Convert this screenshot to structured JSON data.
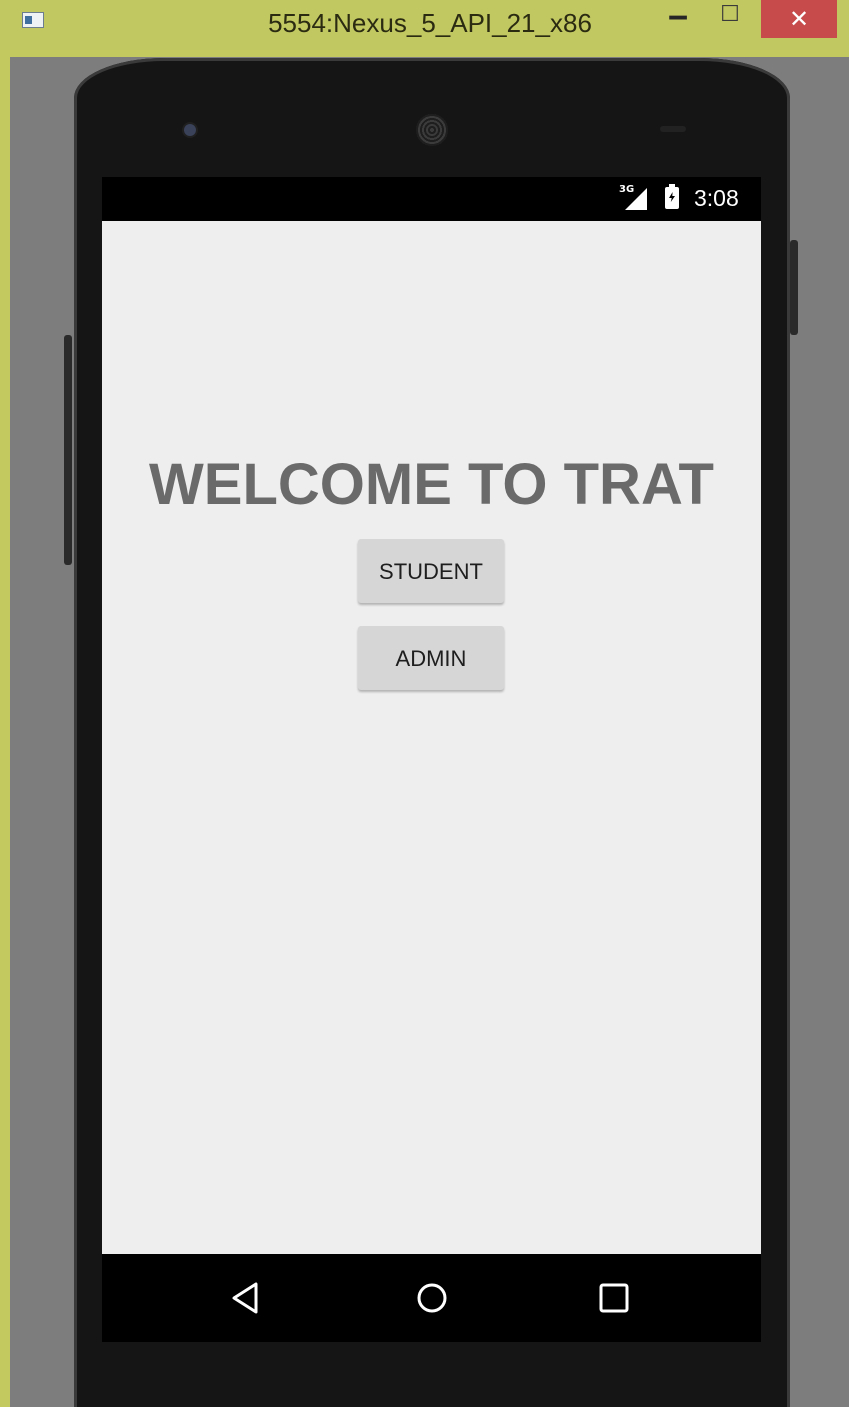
{
  "window": {
    "title": "5554:Nexus_5_API_21_x86",
    "minimize_glyph": "‒",
    "maximize_glyph": "☐",
    "close_glyph": "✕"
  },
  "status_bar": {
    "network_type": "3G",
    "time": "3:08",
    "icons": [
      "signal-icon",
      "battery-charging-icon"
    ]
  },
  "app": {
    "heading": "WELCOME TO TRAT",
    "buttons": {
      "student_label": "STUDENT",
      "admin_label": "ADMIN"
    }
  },
  "nav_bar": {
    "icons": [
      "back-icon",
      "home-icon",
      "recents-icon"
    ]
  },
  "colors": {
    "title_bar": "#c2c861",
    "close_button": "#c74b4b",
    "screen_background": "#eeeeee",
    "heading_text": "#6a6a6a",
    "button_background": "#d6d6d6"
  }
}
